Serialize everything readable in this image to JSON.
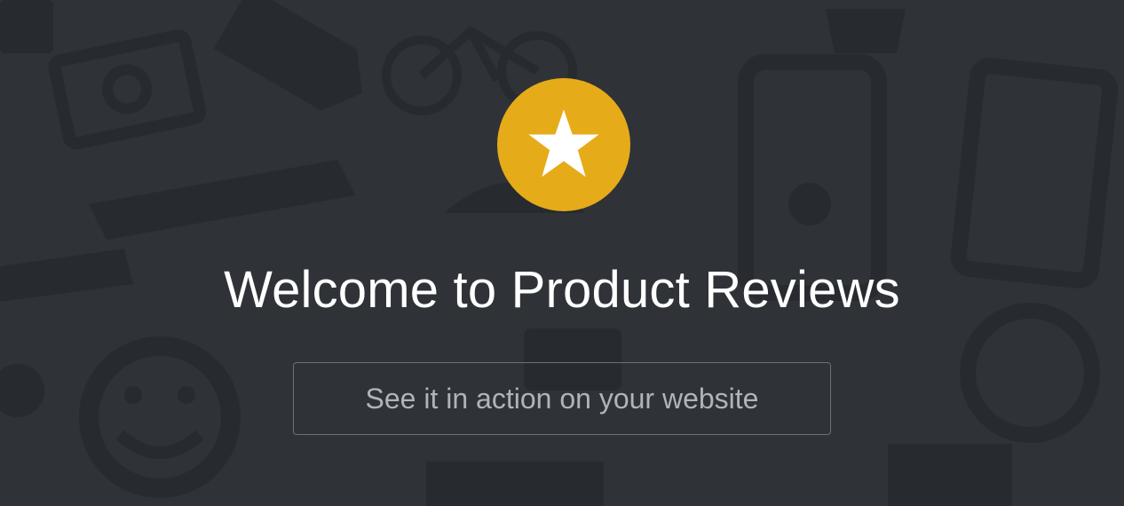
{
  "hero": {
    "icon": "star-icon",
    "title": "Welcome to Product Reviews",
    "cta_label": "See it in action on your website"
  },
  "colors": {
    "background": "#2f3337",
    "pattern": "#262a2e",
    "badge": "#e6ab18",
    "title": "#ffffff",
    "cta_text": "#aeb4ba",
    "cta_border": "#6b7178"
  }
}
